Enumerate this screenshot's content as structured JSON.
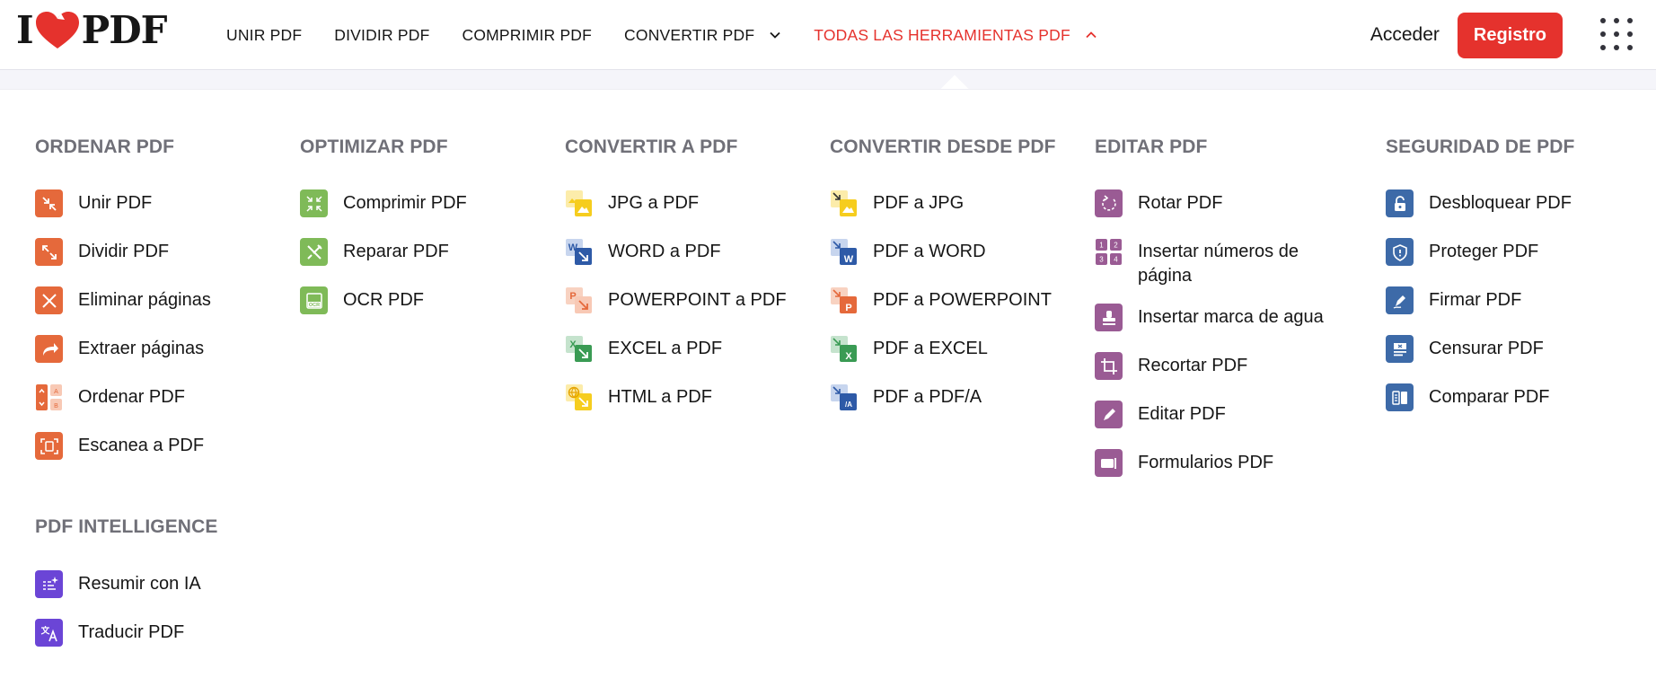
{
  "logo": {
    "left": "I",
    "right": "PDF"
  },
  "nav": [
    {
      "label": "UNIR PDF",
      "active": false,
      "chevron": ""
    },
    {
      "label": "DIVIDIR PDF",
      "active": false,
      "chevron": ""
    },
    {
      "label": "COMPRIMIR PDF",
      "active": false,
      "chevron": ""
    },
    {
      "label": "CONVERTIR PDF",
      "active": false,
      "chevron": "chevron-down-icon"
    },
    {
      "label": "TODAS LAS HERRAMIENTAS PDF",
      "active": true,
      "chevron": "chevron-up-icon"
    }
  ],
  "header": {
    "login_label": "Acceder",
    "signup_label": "Registro"
  },
  "colors": {
    "brand_red": "#e5322d",
    "organize": "#e5693b",
    "optimize": "#7fba58",
    "jpg": "#f6cd1e",
    "word": "#2e5aa7",
    "powerpoint": "#e5693b",
    "excel": "#3a9b54",
    "html": "#f6cd1e",
    "pdfa": "#2e5aa7",
    "edit": "#9a5b94",
    "security": "#3d6aa8",
    "ai": "#6b45d6"
  },
  "menu": {
    "ordenar": {
      "title": "ORDENAR PDF",
      "items": [
        {
          "label": "Unir PDF",
          "icon": "merge-icon"
        },
        {
          "label": "Dividir PDF",
          "icon": "split-icon"
        },
        {
          "label": "Eliminar páginas",
          "icon": "remove-pages-icon"
        },
        {
          "label": "Extraer páginas",
          "icon": "extract-pages-icon"
        },
        {
          "label": "Ordenar PDF",
          "icon": "organize-icon"
        },
        {
          "label": "Escanea a PDF",
          "icon": "scan-icon"
        }
      ]
    },
    "optimizar": {
      "title": "OPTIMIZAR PDF",
      "items": [
        {
          "label": "Comprimir PDF",
          "icon": "compress-icon"
        },
        {
          "label": "Reparar PDF",
          "icon": "repair-icon"
        },
        {
          "label": "OCR PDF",
          "icon": "ocr-icon"
        }
      ]
    },
    "convertir_a": {
      "title": "CONVERTIR A PDF",
      "items": [
        {
          "label": "JPG a PDF",
          "icon": "jpg-to-pdf-icon"
        },
        {
          "label": "WORD a PDF",
          "icon": "word-to-pdf-icon"
        },
        {
          "label": "POWERPOINT a PDF",
          "icon": "powerpoint-to-pdf-icon"
        },
        {
          "label": "EXCEL a PDF",
          "icon": "excel-to-pdf-icon"
        },
        {
          "label": "HTML a PDF",
          "icon": "html-to-pdf-icon"
        }
      ]
    },
    "convertir_desde": {
      "title": "CONVERTIR DESDE PDF",
      "items": [
        {
          "label": "PDF a JPG",
          "icon": "pdf-to-jpg-icon"
        },
        {
          "label": "PDF a WORD",
          "icon": "pdf-to-word-icon"
        },
        {
          "label": "PDF a POWERPOINT",
          "icon": "pdf-to-powerpoint-icon"
        },
        {
          "label": "PDF a EXCEL",
          "icon": "pdf-to-excel-icon"
        },
        {
          "label": "PDF a PDF/A",
          "icon": "pdf-to-pdfa-icon"
        }
      ]
    },
    "editar": {
      "title": "EDITAR PDF",
      "items": [
        {
          "label": "Rotar PDF",
          "icon": "rotate-icon"
        },
        {
          "label": "Insertar números de página",
          "icon": "page-numbers-icon"
        },
        {
          "label": "Insertar marca de agua",
          "icon": "watermark-icon"
        },
        {
          "label": "Recortar PDF",
          "icon": "crop-icon"
        },
        {
          "label": "Editar PDF",
          "icon": "edit-icon"
        },
        {
          "label": "Formularios PDF",
          "icon": "forms-icon"
        }
      ]
    },
    "seguridad": {
      "title": "SEGURIDAD DE PDF",
      "items": [
        {
          "label": "Desbloquear PDF",
          "icon": "unlock-icon"
        },
        {
          "label": "Proteger PDF",
          "icon": "protect-icon"
        },
        {
          "label": "Firmar PDF",
          "icon": "sign-icon"
        },
        {
          "label": "Censurar PDF",
          "icon": "redact-icon"
        },
        {
          "label": "Comparar PDF",
          "icon": "compare-icon"
        }
      ]
    },
    "intelligence": {
      "title": "PDF INTELLIGENCE",
      "items": [
        {
          "label": "Resumir con IA",
          "icon": "summarize-ai-icon"
        },
        {
          "label": "Traducir PDF",
          "icon": "translate-icon"
        }
      ]
    }
  }
}
